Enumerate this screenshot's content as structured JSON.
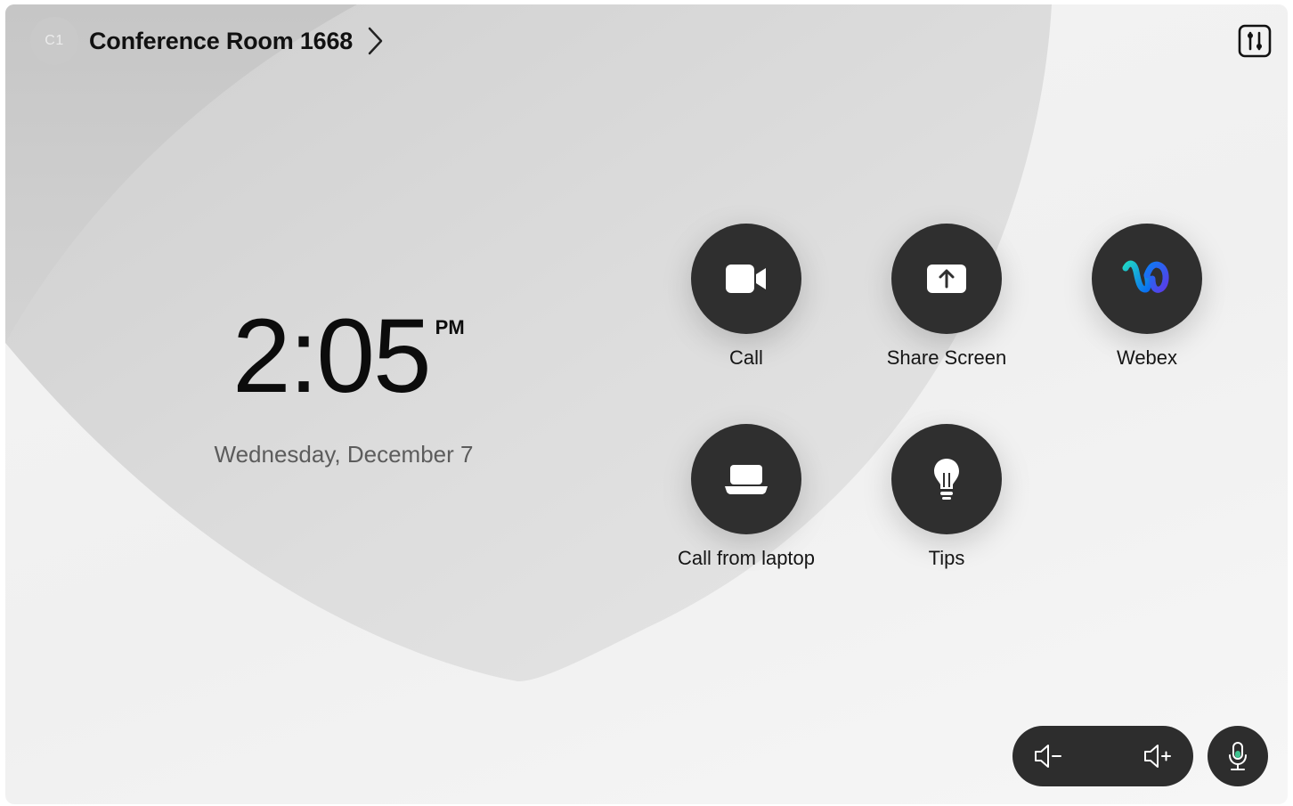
{
  "header": {
    "avatar_initials": "C1",
    "room_name": "Conference Room 1668",
    "chevron_icon": "chevron-right-icon",
    "settings_icon": "sliders-icon"
  },
  "clock": {
    "time": "2:05",
    "ampm": "PM",
    "date": "Wednesday, December 7"
  },
  "apps": [
    {
      "label": "Call",
      "icon": "video-camera-icon"
    },
    {
      "label": "Share Screen",
      "icon": "share-screen-icon"
    },
    {
      "label": "Webex",
      "icon": "webex-logo-icon"
    },
    {
      "label": "Call from laptop",
      "icon": "laptop-icon"
    },
    {
      "label": "Tips",
      "icon": "lightbulb-icon"
    }
  ],
  "controls": {
    "volume_down_icon": "volume-down-icon",
    "volume_up_icon": "volume-up-icon",
    "mic_icon": "microphone-icon"
  },
  "colors": {
    "button_dark": "#2f2f2f",
    "background_light": "#f4f4f4",
    "background_curve": "#d7d7d7",
    "mic_accent": "#3ec28f"
  }
}
